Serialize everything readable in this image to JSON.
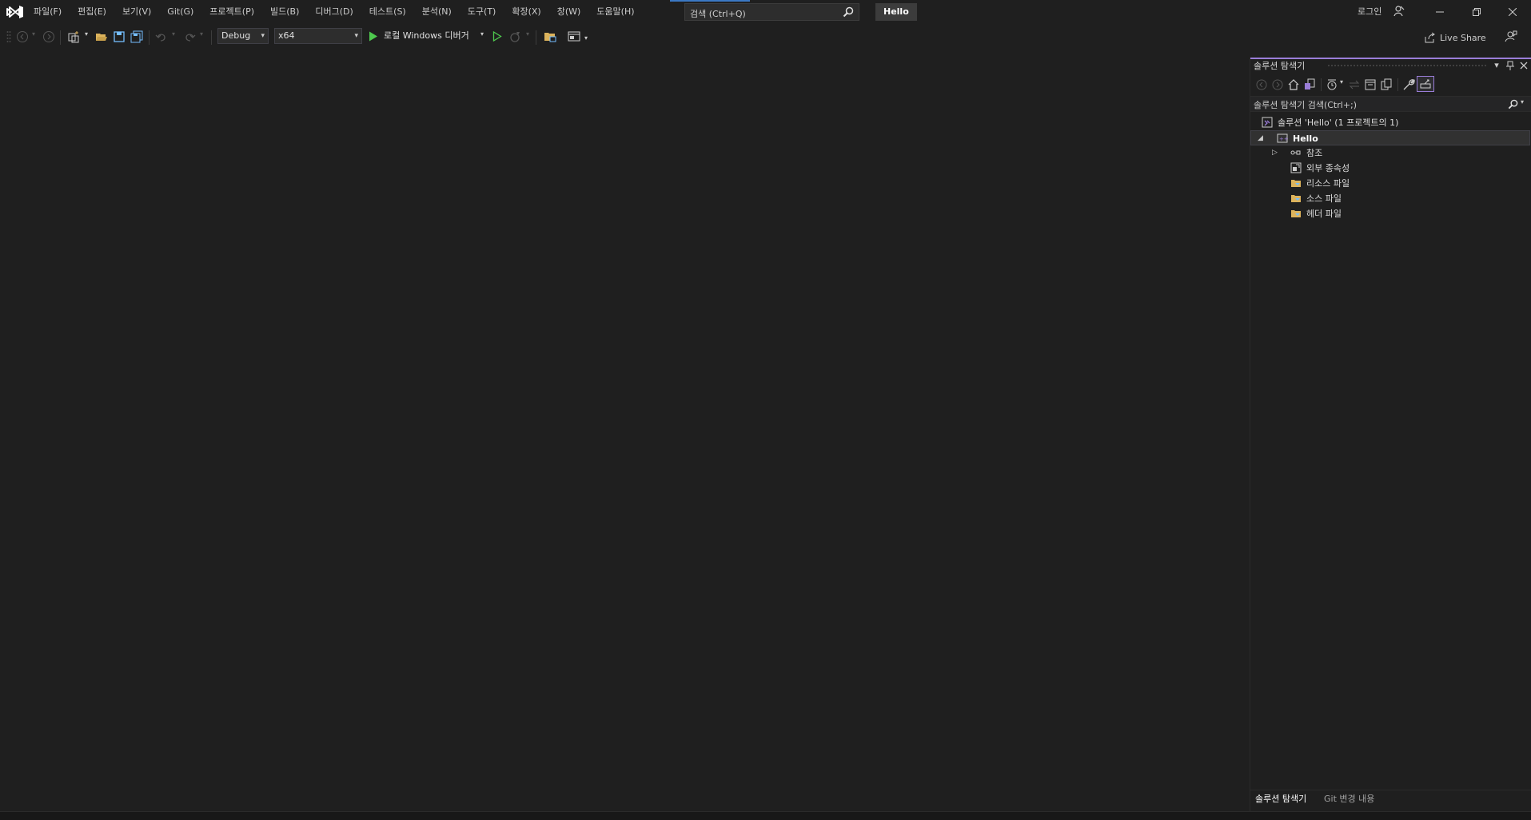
{
  "menu": {
    "items": [
      "파일(F)",
      "편집(E)",
      "보기(V)",
      "Git(G)",
      "프로젝트(P)",
      "빌드(B)",
      "디버그(D)",
      "테스트(S)",
      "분석(N)",
      "도구(T)",
      "확장(X)",
      "창(W)",
      "도움말(H)"
    ]
  },
  "search": {
    "placeholder": "검색 (Ctrl+Q)"
  },
  "solution_name_badge": "Hello",
  "account": {
    "login_label": "로그인"
  },
  "toolbar": {
    "config": "Debug",
    "platform": "x64",
    "run_label": "로컬 Windows 디버거",
    "live_share": "Live Share"
  },
  "solution_explorer": {
    "title": "솔루션 탐색기",
    "search_placeholder": "솔루션 탐색기 검색(Ctrl+;)",
    "solution_label": "솔루션 'Hello' (1 프로젝트의 1)",
    "project": "Hello",
    "nodes": [
      "참조",
      "외부 종속성",
      "리소스 파일",
      "소스 파일",
      "헤더 파일"
    ],
    "tabs": [
      "솔루션 탐색기",
      "Git 변경 내용"
    ]
  },
  "colors": {
    "background": "#1f1f1f",
    "accent_purple": "#9a7dd8",
    "run_green": "#4ec94e",
    "folder_yellow": "#dcb35c"
  }
}
